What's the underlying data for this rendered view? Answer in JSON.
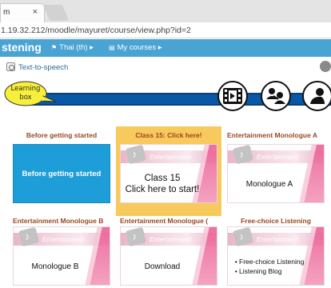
{
  "browser": {
    "tab_label": "m",
    "tab_close": "×",
    "url": "1.19.32.212/moodle/mayuret/course/view.php?id=2"
  },
  "navbar": {
    "brand": "stening",
    "language": "Thai (th)",
    "my_courses": "My courses",
    "caret": "▸"
  },
  "tts_label": "Text-to-speech",
  "learning_box": {
    "label": "Learning box"
  },
  "icons": [
    "video-icon",
    "group-icon",
    "user-icon"
  ],
  "tiles": [
    {
      "title": "Before getting started",
      "style": "blue",
      "body": "Before getting started"
    },
    {
      "title": "Class 15: Click here!",
      "style": "entertainment",
      "header": "Entertainment",
      "body_lines": [
        "Class 15",
        "Click here to start!"
      ]
    },
    {
      "title": "Entertainment Monologue A",
      "style": "entertainment",
      "header": "Entertainment",
      "body": "Monologue A"
    },
    {
      "title": "Entertainment Monologue B",
      "style": "entertainment",
      "header": "Entertainment",
      "body": "Monologue B"
    },
    {
      "title": "Entertainment Monologue (",
      "style": "entertainment",
      "header": "Entertainment",
      "body": "Download"
    },
    {
      "title": "Free-choice Listening",
      "style": "entertainment",
      "header": "Entertainment",
      "list": [
        "Free-choice Listening",
        "Listening Blog"
      ]
    }
  ],
  "colors": {
    "navbar": "#49a3d3",
    "banner": "#0a57a5",
    "highlight": "#f8c95c",
    "tile_title": "#9a4722",
    "blue_tile": "#1e9ed8"
  }
}
